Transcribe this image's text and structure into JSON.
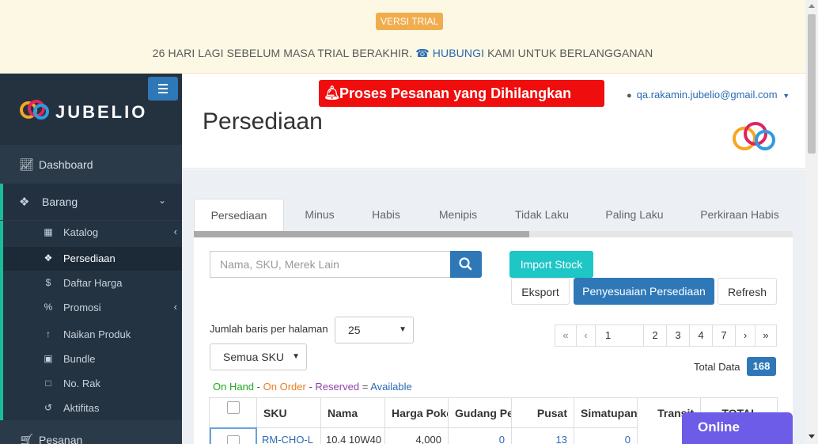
{
  "trial_banner": {
    "badge": "VERSI TRIAL",
    "message_prefix": "26 HARI LAGI SEBELUM MASA TRIAL BERAKHIR.",
    "contact_link": "HUBUNGI",
    "message_suffix": "KAMI UNTUK BERLANGGANAN"
  },
  "brand": {
    "name": "JUBELIO"
  },
  "sidebar": {
    "items": [
      {
        "label": "Dashboard",
        "icon": "area-chart-icon"
      },
      {
        "label": "Barang",
        "icon": "cubes-icon"
      },
      {
        "label": "Pesanan",
        "icon": "cart-icon"
      }
    ],
    "barang_sub": [
      {
        "label": "Katalog",
        "icon": "grid-icon"
      },
      {
        "label": "Persediaan",
        "icon": "cubes-icon"
      },
      {
        "label": "Daftar Harga",
        "icon": "dollar-icon"
      },
      {
        "label": "Promosi",
        "icon": "percent-icon"
      },
      {
        "label": "Naikan Produk",
        "icon": "arrow-up-icon"
      },
      {
        "label": "Bundle",
        "icon": "th-large-icon"
      },
      {
        "label": "No. Rak",
        "icon": "bookmark-icon"
      },
      {
        "label": "Aktifitas",
        "icon": "history-icon"
      }
    ]
  },
  "header": {
    "alert_button": "Proses Pesanan yang Dihilangkan Kurir",
    "user_email": "qa.rakamin.jubelio@gmail.com",
    "page_title": "Persediaan"
  },
  "tabs": [
    "Persediaan",
    "Minus",
    "Habis",
    "Menipis",
    "Tidak Laku",
    "Paling Laku",
    "Perkiraan Habis"
  ],
  "toolbar": {
    "search_placeholder": "Nama, SKU, Merek Lain",
    "import": "Import Stock",
    "eksport": "Eksport",
    "penyesuaian": "Penyesuaian Persediaan",
    "refresh": "Refresh"
  },
  "paging": {
    "rows_label": "Jumlah baris per halaman",
    "rows_value": "25",
    "sku_filter": "Semua SKU",
    "first": "«",
    "prev": "‹",
    "current_input": "1",
    "pages": [
      "2",
      "3",
      "4",
      "7"
    ],
    "next": "›",
    "last": "»",
    "total_label": "Total Data",
    "total_value": "168"
  },
  "legend": {
    "on_hand": "On Hand",
    "on_order": "On Order",
    "reserved": "Reserved",
    "available": "Available"
  },
  "table": {
    "columns": [
      "SKU",
      "Nama",
      "Harga Pokok",
      "Gudang Pe",
      "Pusat",
      "Simatupang",
      "Transit",
      "TOTAL"
    ],
    "rows": [
      {
        "sku": "RM-CHO-L",
        "nama": "10.4 10W40",
        "harga": "4,000",
        "gudang": "0",
        "pusat": "13",
        "simatupang": "0"
      }
    ]
  },
  "chat_widget": {
    "label": "Online"
  },
  "colors": {
    "primary": "#2f78b8",
    "alert": "#f00d0d",
    "teal": "#1ec6c6",
    "sidebar": "#2b3a48",
    "chat": "#6c5ce7"
  }
}
